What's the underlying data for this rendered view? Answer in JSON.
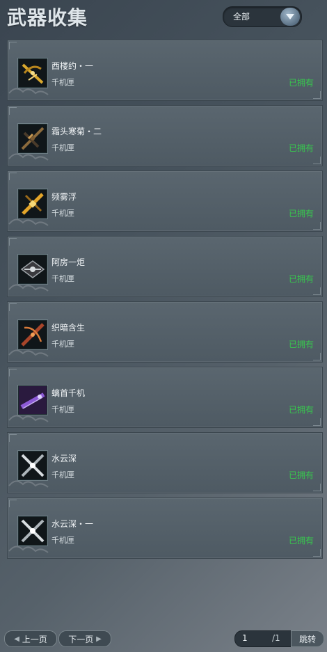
{
  "header": {
    "title": "武器收集"
  },
  "filter": {
    "selected": "全部",
    "icon": "chevron-down-icon"
  },
  "items": [
    {
      "name": "西楼约・一",
      "type": "千机匣",
      "status": "已拥有",
      "icon": "weapon-gold-crossbow-icon"
    },
    {
      "name": "霜头寒菊・二",
      "type": "千机匣",
      "status": "已拥有",
      "icon": "weapon-dark-crossbow-icon"
    },
    {
      "name": "频雾浮",
      "type": "千机匣",
      "status": "已拥有",
      "icon": "weapon-yellow-crossbow-icon"
    },
    {
      "name": "阿房一炬",
      "type": "千机匣",
      "status": "已拥有",
      "icon": "weapon-silver-crossbow-icon"
    },
    {
      "name": "织暗含生",
      "type": "千机匣",
      "status": "已拥有",
      "icon": "weapon-red-crossbow-icon"
    },
    {
      "name": "螭首千机",
      "type": "千机匣",
      "status": "已拥有",
      "icon": "weapon-purple-crossbow-icon"
    },
    {
      "name": "水云深",
      "type": "千机匣",
      "status": "已拥有",
      "icon": "weapon-white-crossbow-icon"
    },
    {
      "name": "水云深・一",
      "type": "千机匣",
      "status": "已拥有",
      "icon": "weapon-white-crossbow-icon"
    }
  ],
  "pager": {
    "prev_label": "上一页",
    "next_label": "下一页",
    "current_page": "1",
    "total": "/1",
    "jump_label": "跳转"
  },
  "colors": {
    "owned": "#37c94d",
    "card_bg": "#56626b",
    "accent": "#5b7185"
  }
}
